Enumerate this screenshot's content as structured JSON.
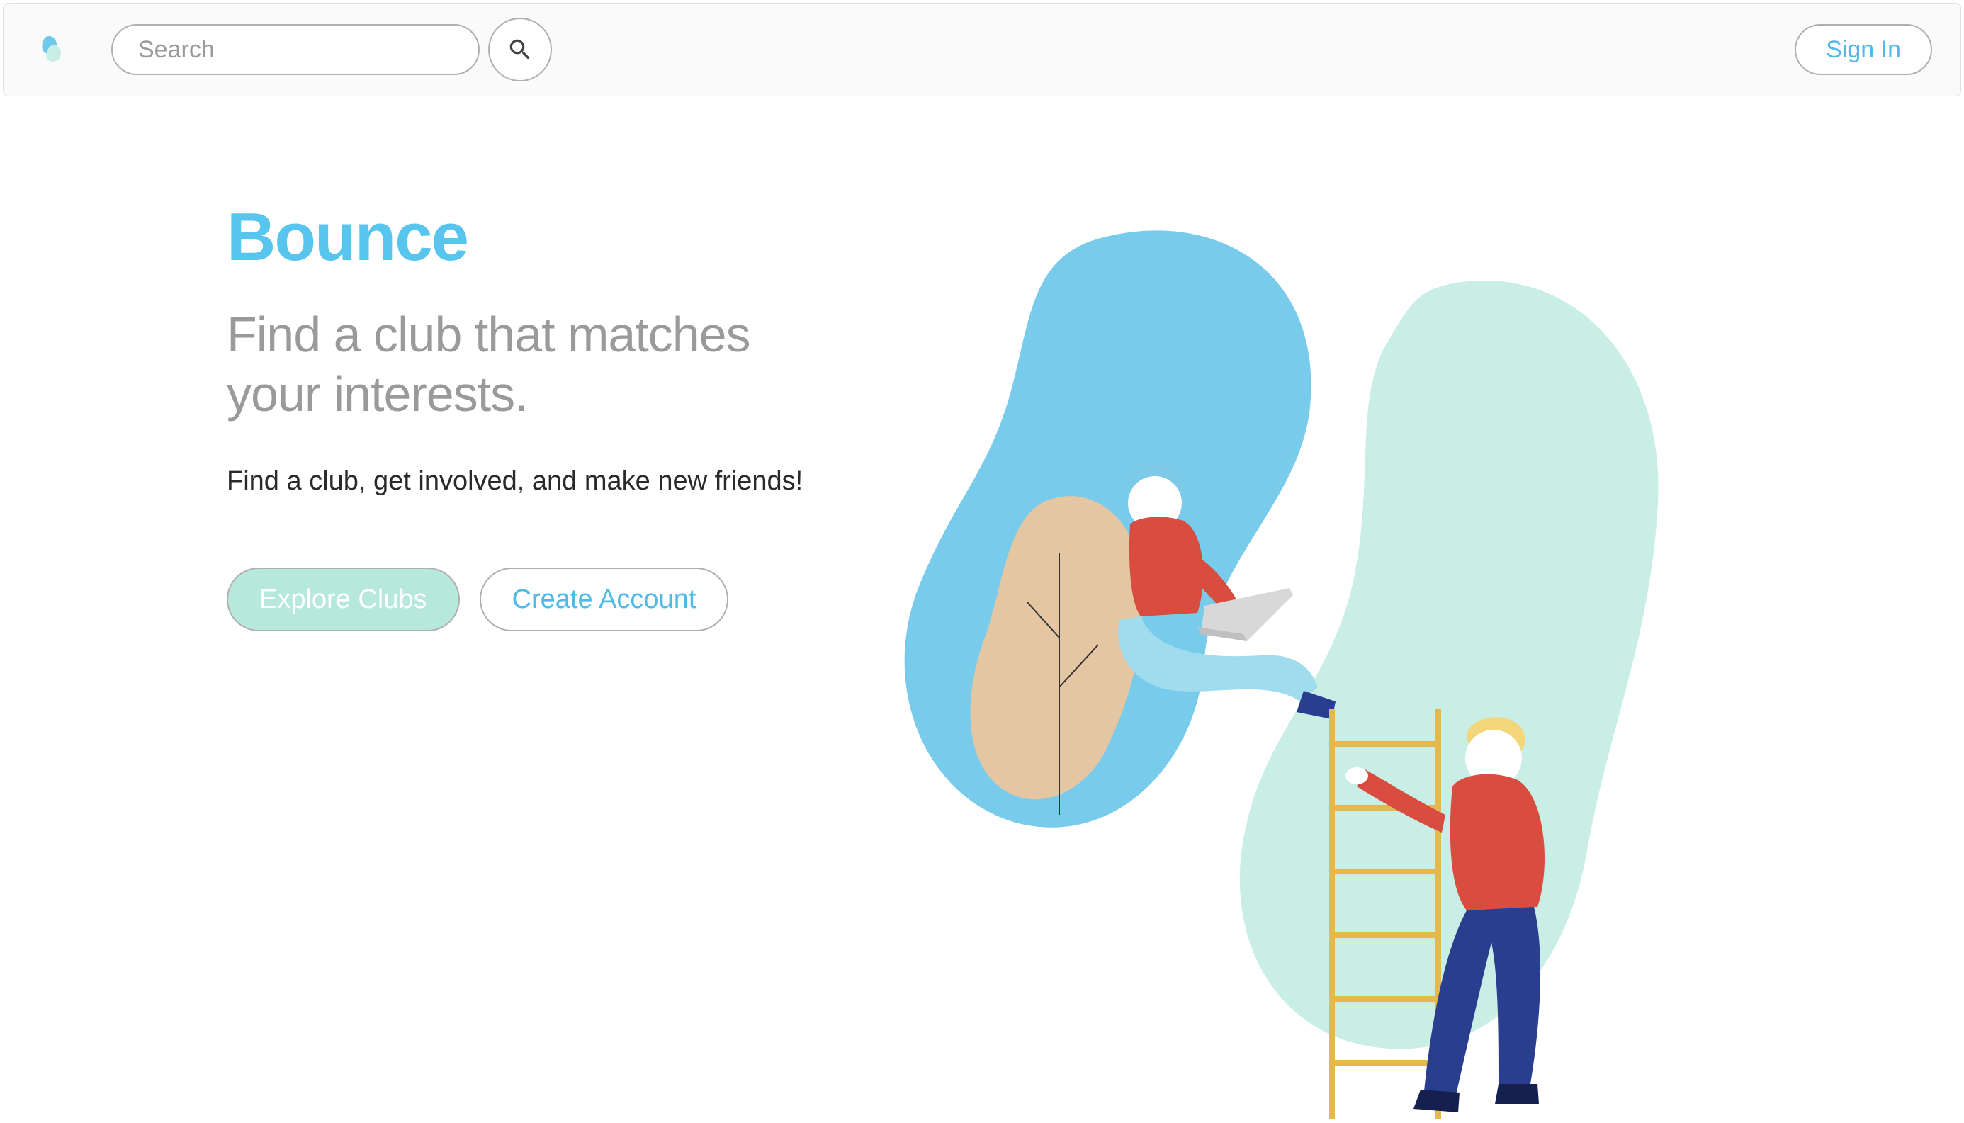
{
  "header": {
    "search_placeholder": "Search",
    "signin_label": "Sign In"
  },
  "hero": {
    "brand": "Bounce",
    "headline": "Find a club that matches your interests.",
    "description": "Find a club, get involved, and make new friends!",
    "explore_label": "Explore Clubs",
    "create_label": "Create Account"
  },
  "colors": {
    "accent_blue": "#58c5ef",
    "mint": "#b7e8dc",
    "light_mint": "#c6eee4",
    "grey_text": "#9a9a9a"
  }
}
